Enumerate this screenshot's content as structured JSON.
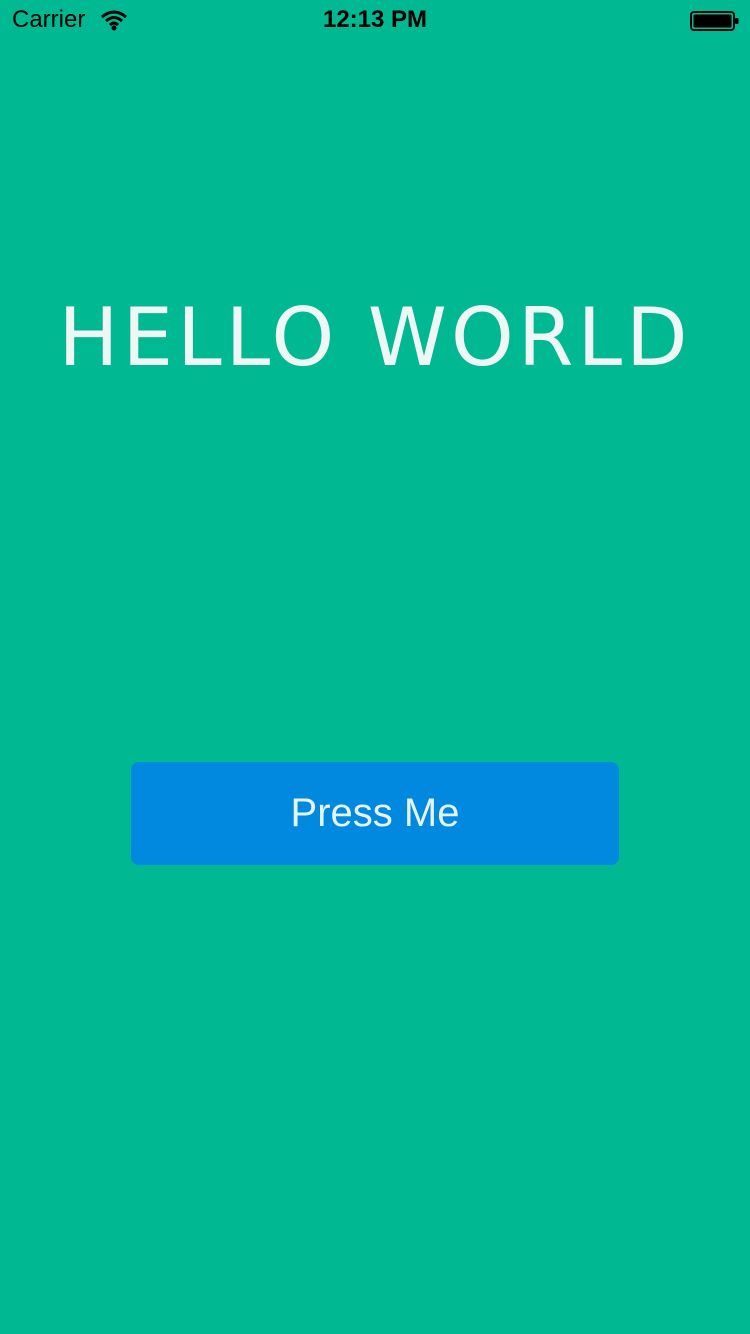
{
  "status_bar": {
    "carrier": "Carrier",
    "time": "12:13 PM",
    "wifi_icon": "wifi-icon",
    "battery_icon": "battery-icon"
  },
  "main": {
    "title": "HELLO WORLD",
    "button_label": "Press Me"
  },
  "colors": {
    "background": "#00B891",
    "button": "#0089DE",
    "title_text": "#EEF7F4",
    "button_text": "#E7F3FB"
  }
}
